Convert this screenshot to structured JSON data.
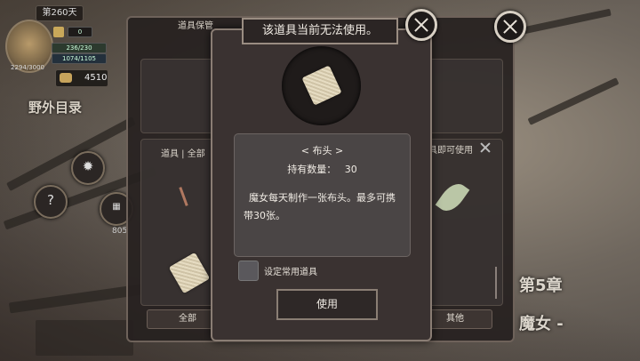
{
  "hud": {
    "day_label": "第260天",
    "counter": "0",
    "bar_top": "236/230",
    "bar_bottom": "1074/1105",
    "hp_text": "2294/3000",
    "coins": "4510",
    "area_title": "野外目录",
    "help_symbol": "?",
    "number_805": "805"
  },
  "back_panel": {
    "title": "道具保管",
    "tabs": "道具 | 全部",
    "right_hint": "具即可使用",
    "btn_all": "全部",
    "btn_other": "其他"
  },
  "world": {
    "chapter": "第5章",
    "chapter_sub": "魔女 -"
  },
  "modal": {
    "title": "该道具当前无法使用。",
    "item_name": "< 布头 >",
    "count_label": "持有数量：",
    "count_value": "30",
    "description_line1": "魔女每天制作一张布头。最多可携",
    "description_line2": "带30张。",
    "checkbox_label": "设定常用道具",
    "use_button": "使用"
  },
  "colors": {
    "panel_bg": "#3a3231",
    "border": "#8a7d74",
    "desc_bg": "#4a4545"
  },
  "icons": [
    "close-icon",
    "settings-gear-icon",
    "help-icon",
    "cloth-item-icon",
    "leaf-item-icon",
    "coin-icon"
  ]
}
